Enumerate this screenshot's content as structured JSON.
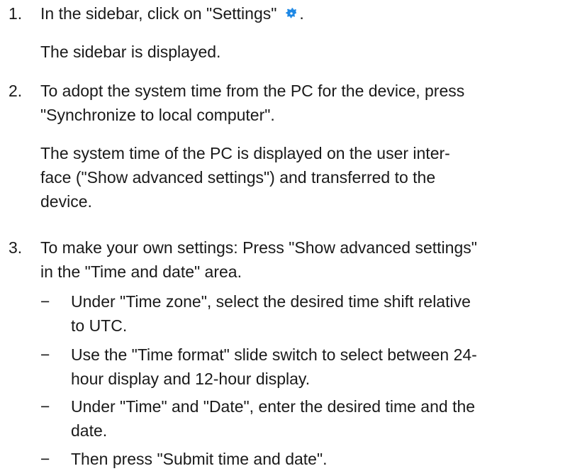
{
  "steps": [
    {
      "number": "1.",
      "text_before_icon": "In the sidebar, click on \"Settings\"",
      "text_after_icon": ".",
      "icon": "gear-icon",
      "result": "The sidebar is displayed."
    },
    {
      "number": "2.",
      "line1": "To adopt the system time from the PC for the device, press",
      "line2": "\"Synchronize to local computer\".",
      "result_line1": "The system time of the PC is displayed on the user inter-",
      "result_line2": "face (\"Show advanced settings\") and transferred to the",
      "result_line3": "device."
    },
    {
      "number": "3.",
      "line1": "To make your own settings: Press \"Show advanced settings\"",
      "line2": "in the \"Time and date\" area.",
      "bullet_marker": "−",
      "bullets": [
        {
          "line1": "Under \"Time zone\", select the desired time shift relative",
          "line2": "to UTC."
        },
        {
          "line1": "Use the \"Time format\" slide switch to select between 24-",
          "line2": "hour display and 12-hour display."
        },
        {
          "line1": "Under \"Time\" and \"Date\", enter the desired time and the",
          "line2": "date."
        },
        {
          "line1": "Then press \"Submit time and date\"."
        }
      ]
    }
  ],
  "colors": {
    "text": "#1a1a1a",
    "icon": "#1e88e5"
  }
}
